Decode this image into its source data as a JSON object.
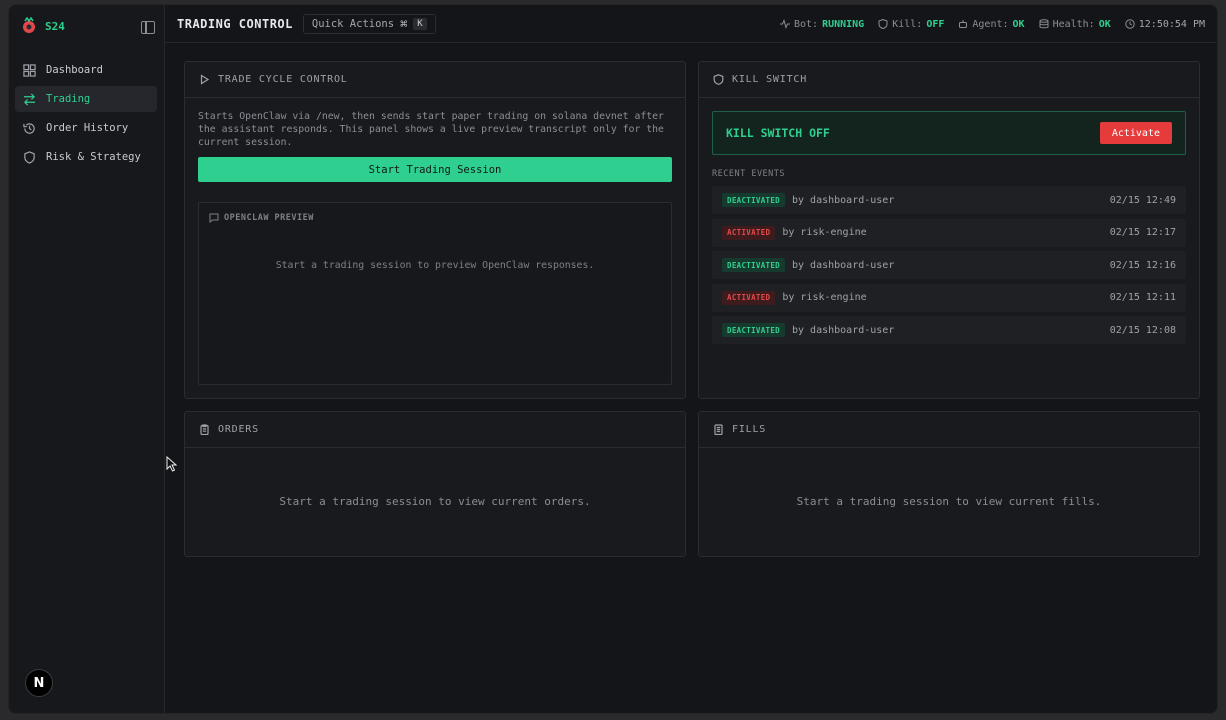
{
  "brand": {
    "name": "S24"
  },
  "sidebar": {
    "items": [
      {
        "label": "Dashboard",
        "icon": "grid-icon"
      },
      {
        "label": "Trading",
        "icon": "arrows-icon",
        "active": true
      },
      {
        "label": "Order History",
        "icon": "history-icon"
      },
      {
        "label": "Risk & Strategy",
        "icon": "shield-icon"
      }
    ],
    "badge": "N"
  },
  "header": {
    "title": "TRADING CONTROL",
    "quick_actions": "Quick Actions",
    "shortcut_cmd": "⌘",
    "shortcut_key": "K",
    "status": {
      "bot_label": "Bot:",
      "bot_value": "RUNNING",
      "kill_label": "Kill:",
      "kill_value": "OFF",
      "agent_label": "Agent:",
      "agent_value": "OK",
      "health_label": "Health:",
      "health_value": "OK",
      "time": "12:50:54 PM"
    }
  },
  "trade_cycle": {
    "title": "TRADE CYCLE CONTROL",
    "description": "Starts OpenClaw via /new, then sends start paper trading on solana devnet after the assistant responds. This panel shows a live preview transcript only for the current session.",
    "start_button": "Start Trading Session",
    "preview_title": "OPENCLAW PREVIEW",
    "preview_empty": "Start a trading session to preview OpenClaw responses."
  },
  "kill_switch": {
    "title": "KILL SWITCH",
    "status": "KILL SWITCH OFF",
    "activate_button": "Activate",
    "events_title": "RECENT EVENTS",
    "events": [
      {
        "type": "DEACTIVATED",
        "by": "by dashboard-user",
        "time": "02/15 12:49"
      },
      {
        "type": "ACTIVATED",
        "by": "by risk-engine",
        "time": "02/15 12:17"
      },
      {
        "type": "DEACTIVATED",
        "by": "by dashboard-user",
        "time": "02/15 12:16"
      },
      {
        "type": "ACTIVATED",
        "by": "by risk-engine",
        "time": "02/15 12:11"
      },
      {
        "type": "DEACTIVATED",
        "by": "by dashboard-user",
        "time": "02/15 12:08"
      }
    ]
  },
  "orders": {
    "title": "ORDERS",
    "empty": "Start a trading session to view current orders."
  },
  "fills": {
    "title": "FILLS",
    "empty": "Start a trading session to view current fills."
  },
  "colors": {
    "accent": "#2fcf8f",
    "danger": "#e53b3b",
    "background": "#141518"
  }
}
